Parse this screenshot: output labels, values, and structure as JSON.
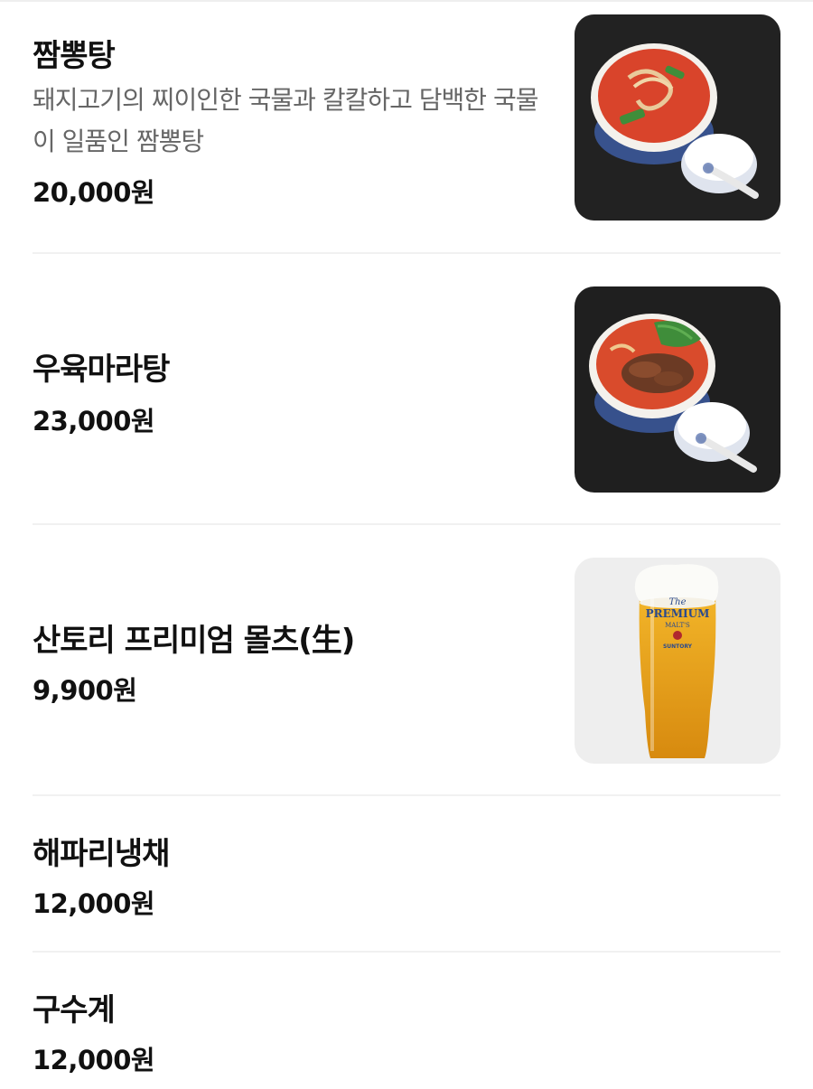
{
  "menu": {
    "items": [
      {
        "name": "짬뽕탕",
        "description": "돼지고기의 찌이인한 국물과 칼칼하고 담백한 국물이 일품인 짬뽕탕",
        "price": "20,000원",
        "image_icon": "jjamppong-soup-photo"
      },
      {
        "name": "우육마라탕",
        "price": "23,000원",
        "image_icon": "beef-mala-soup-photo"
      },
      {
        "name": "산토리 프리미엄 몰츠(生)",
        "price": "9,900원",
        "image_icon": "beer-glass-photo",
        "image_label": {
          "line1": "The",
          "line2": "PREMIUM",
          "line3": "MALT'S",
          "line4": "SUNTORY"
        }
      },
      {
        "name": "해파리냉채",
        "price": "12,000원"
      },
      {
        "name": "구수계",
        "price": "12,000원"
      }
    ]
  },
  "colors": {
    "name_text": "#111111",
    "desc_text": "#666666",
    "divider": "#f1f1f1",
    "photo_bg_dark": "#1f1f1f",
    "soup_red": "#d9442b",
    "beer_gold": "#e9a21a"
  }
}
